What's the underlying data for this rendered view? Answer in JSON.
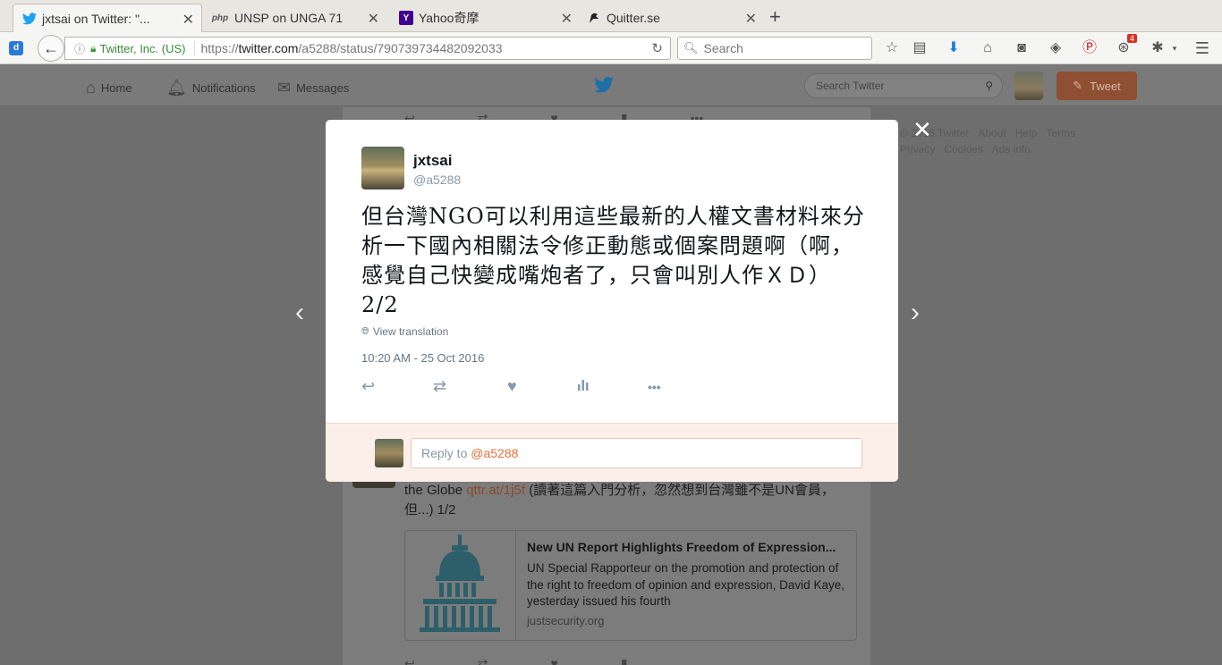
{
  "browser": {
    "tabs": [
      {
        "title": "jxtsai on Twitter: \"...",
        "favicon": "twitter-icon",
        "active": true
      },
      {
        "title": "UNSP on UNGA 71",
        "favicon": "php-icon",
        "favicon_text": "php"
      },
      {
        "title": "Yahoo奇摩",
        "favicon": "yahoo-icon",
        "favicon_text": "Y"
      },
      {
        "title": "Quitter.se",
        "favicon": "quitter-icon"
      }
    ],
    "identity": "Twitter, Inc. (US)",
    "url_prefix": "https://",
    "url_host": "twitter.com",
    "url_path": "/a5288/status/790739734482092033",
    "search_placeholder": "Search",
    "notification_badge": "4"
  },
  "twitter_header": {
    "nav": [
      "Home",
      "Notifications",
      "Messages"
    ],
    "search_placeholder": "Search Twitter",
    "tweet_button": "Tweet"
  },
  "modal": {
    "name": "jxtsai",
    "handle": "@a5288",
    "text": "但台灣NGO可以利用這些最新的人權文書材料來分析一下國內相關法令修正動態或個案問題啊（啊，感覺自己快變成嘴炮者了，只會叫別人作ＸＤ） 2/2",
    "translate": "View translation",
    "timestamp": "10:20 AM - 25 Oct 2016",
    "reply_prefix": "Reply to ",
    "reply_mention": "@a5288"
  },
  "background": {
    "tweet_text_pre": "the Globe ",
    "tweet_link": "qttr.at/1j5f",
    "tweet_text_post": " (讀著這篇入門分析，忽然想到台灣雖不是UN會員，但...) 1/2",
    "card_title": "New UN Report Highlights Freedom of Expression...",
    "card_desc": "UN Special Rapporteur on the promotion and protection of the right to freedom of opinion and expression, David Kaye, yesterday issued his fourth",
    "card_domain": "justsecurity.org",
    "footer_links": [
      "© 2016 Twitter",
      "About",
      "Help",
      "Terms",
      "Privacy",
      "Cookies",
      "Ads info"
    ]
  },
  "colors": {
    "accent": "#e8703a",
    "twitter_blue": "#1da1f2",
    "overlay": "#6e6e6e"
  }
}
